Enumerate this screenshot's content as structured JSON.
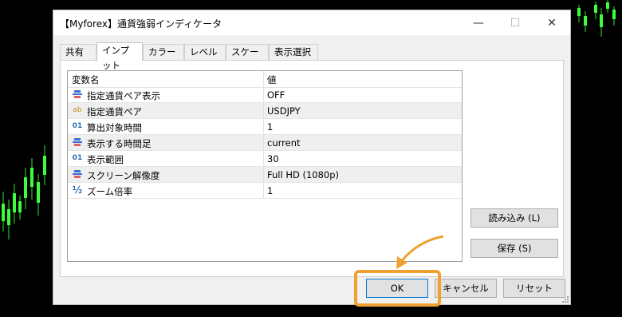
{
  "dialog": {
    "title": "【Myforex】通貨強弱インディケータ",
    "controls": {
      "minimize": "—",
      "maximize": "☐",
      "close": "✕"
    }
  },
  "tabs": [
    {
      "label": "共有",
      "active": false
    },
    {
      "label": "インプット",
      "active": true
    },
    {
      "label": "カラー",
      "active": false
    },
    {
      "label": "レベル",
      "active": false
    },
    {
      "label": "スケール",
      "active": false
    },
    {
      "label": "表示選択",
      "active": false
    }
  ],
  "grid": {
    "headers": {
      "name": "変数名",
      "value": "値"
    },
    "rows": [
      {
        "icon": "enum-icon",
        "name": "指定通貨ペア表示",
        "value": "OFF"
      },
      {
        "icon": "string-icon",
        "name": "指定通貨ペア",
        "value": "USDJPY"
      },
      {
        "icon": "int-icon",
        "name": "算出対象時間",
        "value": "1"
      },
      {
        "icon": "enum-icon",
        "name": "表示する時間足",
        "value": "current"
      },
      {
        "icon": "int-icon",
        "name": "表示範囲",
        "value": "30"
      },
      {
        "icon": "enum-icon",
        "name": "スクリーン解像度",
        "value": "Full HD (1080p)"
      },
      {
        "icon": "double-icon",
        "name": "ズーム倍率",
        "value": "1"
      }
    ]
  },
  "icon_glyphs": {
    "enum-icon": "",
    "string-icon": "ab",
    "int-icon": "01",
    "double-icon": "½"
  },
  "side_buttons": {
    "load": "読み込み (L)",
    "save": "保存 (S)"
  },
  "footer_buttons": {
    "ok": "OK",
    "cancel": "キャンセル",
    "reset": "リセット"
  },
  "colors": {
    "highlight": "#f0a030",
    "candle": "#33ff33",
    "enum_icon": "#3a6fd8",
    "string_icon": "#c88a1a",
    "int_icon": "#2a6fb0"
  }
}
